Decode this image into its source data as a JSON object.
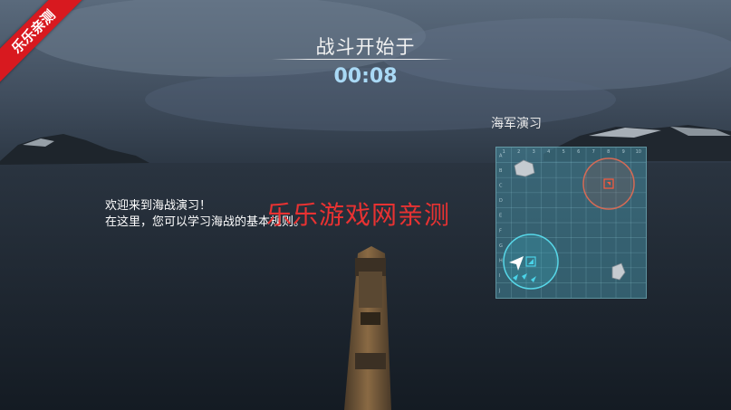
{
  "watermark_corner": "乐乐亲测",
  "battle": {
    "title": "战斗开始于",
    "countdown": "00:08"
  },
  "intro": {
    "line1": "欢迎来到海战演习！",
    "line2": "在这里，您可以学习海战的基本规则。"
  },
  "watermark_center": "乐乐游戏网亲测",
  "minimap": {
    "label": "海军演习",
    "col_numbers": [
      "1",
      "2",
      "3",
      "4",
      "5",
      "6",
      "7",
      "8",
      "9",
      "10"
    ],
    "row_letters": [
      "A",
      "B",
      "C",
      "D",
      "E",
      "F",
      "G",
      "H",
      "I",
      "J"
    ]
  },
  "colors": {
    "countdown": "#a9d9f5",
    "watermark": "#e83232",
    "ribbon": "#d8191f",
    "ally": "#4ad3e8",
    "enemy": "#e04a3a"
  }
}
